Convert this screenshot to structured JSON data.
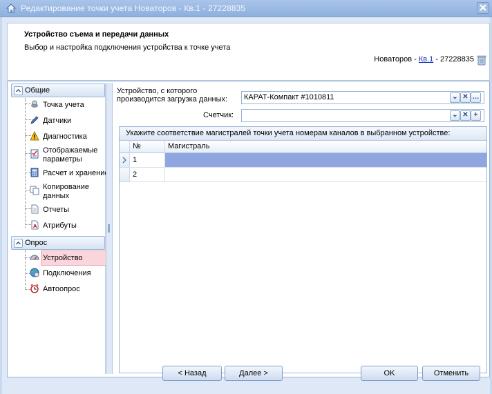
{
  "window": {
    "title": "Редактирование точки учета Новаторов - Кв.1 - 27228835",
    "icons": {
      "app": "home-icon",
      "close": "close-icon"
    }
  },
  "header": {
    "title": "Устройство съема и передачи данных",
    "subtitle": "Выбор и настройка подключения устройства к точке учета",
    "location_prefix": "Новаторов - ",
    "location_link": "Кв.1",
    "location_suffix": " - 27228835"
  },
  "sidebar": {
    "groups": [
      {
        "label": "Общие",
        "items": [
          {
            "label": "Точка учета",
            "icon": "meter-icon"
          },
          {
            "label": "Датчики",
            "icon": "pencil-icon"
          },
          {
            "label": "Диагностика",
            "icon": "warning-icon"
          },
          {
            "label1": "Отображаемые",
            "label2": "параметры",
            "icon": "checklist-icon"
          },
          {
            "label": "Расчет и хранение",
            "icon": "calculator-icon"
          },
          {
            "label1": "Копирование",
            "label2": "данных",
            "icon": "copy-icon"
          },
          {
            "label": "Отчеты",
            "icon": "document-icon"
          },
          {
            "label": "Атрибуты",
            "icon": "attributes-icon"
          }
        ]
      },
      {
        "label": "Опрос",
        "items": [
          {
            "label": "Устройство",
            "icon": "device-icon",
            "selected": true
          },
          {
            "label": "Подключения",
            "icon": "connection-icon"
          },
          {
            "label": "Автоопрос",
            "icon": "alarm-clock-icon"
          }
        ]
      }
    ]
  },
  "form": {
    "device_label_line1": "Устройство, с которого",
    "device_label_line2": "производится загрузка данных:",
    "device_value": "КАРАТ-Компакт #1010811",
    "meter_label": "Счетчик:",
    "meter_value": ""
  },
  "grid": {
    "caption": "Укажите соответствие магистралей точки учета номерам каналов в выбранном устройстве:",
    "columns": [
      "№",
      "Магистраль"
    ],
    "rows": [
      {
        "num": "1",
        "line": "",
        "selected": true
      },
      {
        "num": "2",
        "line": "",
        "selected": false
      }
    ]
  },
  "footer": {
    "back": "< Назад",
    "next": "Далее >",
    "ok": "OK",
    "cancel": "Отменить"
  },
  "colors": {
    "title_bar": "#8eb0de",
    "selected_row": "#8fa6e0",
    "selected_nav": "#fbd5dc",
    "link": "#0b2fb8"
  }
}
